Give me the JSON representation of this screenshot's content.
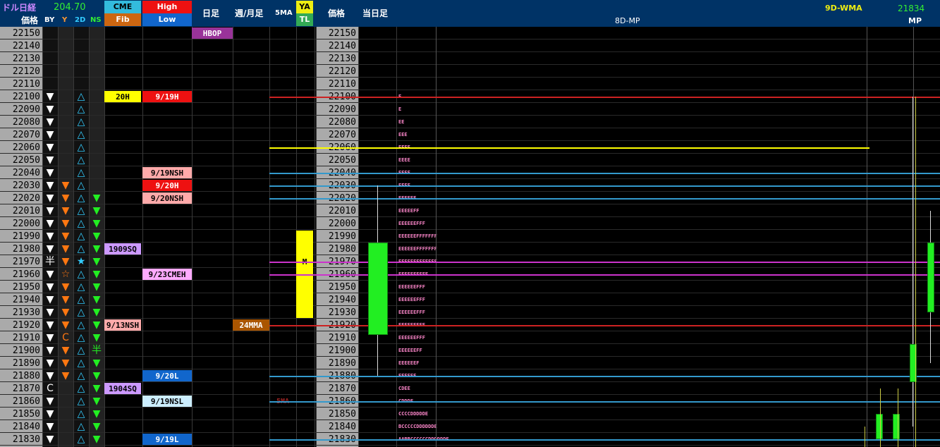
{
  "header": {
    "instrument_label": "ドル日経",
    "price_label": "価格",
    "spread": "204.70",
    "col_by": "BY",
    "col_y": "Y",
    "col_2d": "2D",
    "col_ns": "NS",
    "cme": "CME",
    "fib": "Fib",
    "high": "High",
    "low": "Low",
    "daily": "日足",
    "weekly_monthly": "週/月足",
    "ma5": "5MA",
    "ya": "YA",
    "tl": "TL",
    "price2": "価格",
    "today_bar": "当日足",
    "mp_title": "8D-MP",
    "wma_label": "9D-WMA",
    "wma_value": "21834",
    "mp_label": "MP"
  },
  "prices": [
    "22150",
    "22140",
    "22130",
    "22120",
    "22110",
    "22100",
    "22090",
    "22080",
    "22070",
    "22060",
    "22050",
    "22040",
    "22030",
    "22020",
    "22010",
    "22000",
    "21990",
    "21980",
    "21970",
    "21960",
    "21950",
    "21940",
    "21930",
    "21920",
    "21910",
    "21900",
    "21890",
    "21880",
    "21870",
    "21860",
    "21850",
    "21840",
    "21830"
  ],
  "by": [
    "",
    "",
    "",
    "",
    "",
    "▼",
    "▼",
    "▼",
    "▼",
    "▼",
    "▼",
    "▼",
    "▼",
    "▼",
    "▼",
    "▼",
    "▼",
    "▼",
    "半",
    "▼",
    "▼",
    "▼",
    "▼",
    "▼",
    "▼",
    "▼",
    "▼",
    "▼",
    "C",
    "▼",
    "▼",
    "▼",
    "▼"
  ],
  "y": [
    "",
    "",
    "",
    "",
    "",
    "",
    "",
    "",
    "",
    "",
    "",
    "",
    "▼",
    "▼",
    "▼",
    "▼",
    "▼",
    "▼",
    "▼",
    "☆",
    "▼",
    "▼",
    "▼",
    "▼",
    "C",
    "▼",
    "▼",
    "▼",
    "",
    "",
    "",
    "",
    ""
  ],
  "d2": [
    "",
    "",
    "",
    "",
    "",
    "△",
    "△",
    "△",
    "△",
    "△",
    "△",
    "△",
    "△",
    "△",
    "△",
    "△",
    "△",
    "△",
    "★",
    "△",
    "△",
    "△",
    "△",
    "△",
    "△",
    "△",
    "△",
    "△",
    "△",
    "△",
    "△",
    "△",
    "△"
  ],
  "ns": [
    "",
    "",
    "",
    "",
    "",
    "",
    "",
    "",
    "",
    "",
    "",
    "",
    "",
    "▼",
    "▼",
    "▼",
    "▼",
    "▼",
    "▼",
    "▼",
    "▼",
    "▼",
    "▼",
    "▼",
    "▼",
    "半",
    "▼",
    "▼",
    "▼",
    "▼",
    "▼",
    "▼",
    "▼"
  ],
  "labels": {
    "fib_20h": "20H",
    "fib_1909sq": "1909SQ",
    "fib_913nsh": "9/13NSH",
    "fib_1904sq": "1904SQ",
    "hl_919h": "9/19H",
    "hl_919nsh": "9/19NSH",
    "hl_920h": "9/20H",
    "hl_920nsh": "9/20NSH",
    "hl_923cmeh": "9/23CMEH",
    "hl_920l": "9/20L",
    "hl_919nsl": "9/19NSL",
    "hl_919l": "9/19L",
    "hbop": "HBOP",
    "ma24": "24MMA",
    "ya_m": "M",
    "ma5_line": "5MA"
  },
  "mp_profile": [
    "",
    "",
    "",
    "",
    "",
    "E",
    "E",
    "EE",
    "EEE",
    "EEEE",
    "EEEE",
    "EEEE",
    "EEEF",
    "EEEEFF",
    "EEEEEFF",
    "EEEEEEFFF",
    "EEEEEEFFFFFFF",
    "EEEEEEFFFFFFF",
    "EEEEEEFFFFFFF",
    "EEEEEEFFFF",
    "EEEEEEFFF",
    "EEEEEEFFF",
    "EEEEEEFFF",
    "EEEEEEFFF",
    "EEEEEEFFF",
    "EEEEEEFF",
    "EEEEEEF",
    "EEEEEE",
    "CDEE",
    "CDDDE",
    "CCCCDDDDDE",
    "BCCCCCDDDDDDE",
    "AABBCCCCCCDDDDDDE"
  ],
  "colors": {
    "red_line": "#cc2222",
    "yellow_line": "#ffff00",
    "blue_line": "#3399cc",
    "magenta_line": "#cc33cc",
    "candle_green": "#22ee22"
  }
}
